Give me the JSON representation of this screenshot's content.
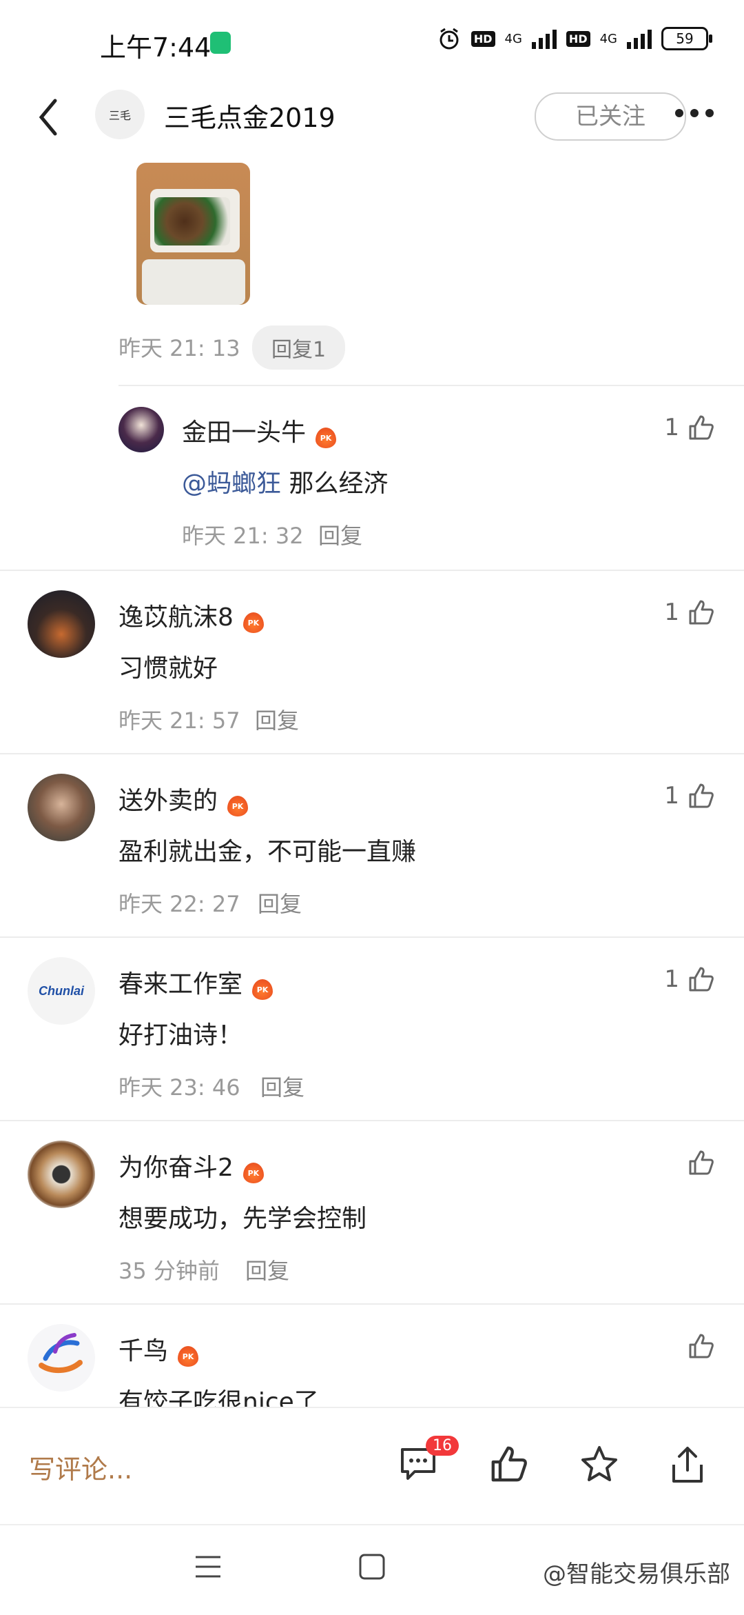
{
  "status_bar": {
    "time": "上午7:44",
    "hd1": "HD",
    "net1": "4G",
    "hd2": "HD",
    "net2": "4G",
    "battery": "59"
  },
  "header": {
    "avatar_text": "三毛",
    "title": "三毛点金2019",
    "follow_label": "已关注"
  },
  "first_reply": {
    "time": "昨天 21: 13",
    "reply_label": "回复1"
  },
  "comments": [
    {
      "name": "金田一头牛",
      "mention": "@蚂螂狂",
      "text": " 那么经济",
      "time": "昨天 21: 32",
      "reply": "回复",
      "likes": "1",
      "badge": "PK"
    },
    {
      "name": "逸苡航沫8",
      "text": "习惯就好",
      "time": "昨天 21: 57",
      "reply": "回复",
      "likes": "1",
      "badge": "PK"
    },
    {
      "name": "送外卖的",
      "text": "盈利就出金，不可能一直赚",
      "time": "昨天 22: 27",
      "reply": "回复",
      "likes": "1",
      "badge": "PK"
    },
    {
      "name": "春来工作室",
      "avatar_text": "Chunlai",
      "text": "好打油诗！",
      "time": "昨天 23: 46",
      "reply": "回复",
      "likes": "1",
      "badge": "PK"
    },
    {
      "name": "为你奋斗2",
      "text": "想要成功，先学会控制",
      "time": "35 分钟前",
      "reply": "回复",
      "likes": "",
      "badge": "PK"
    },
    {
      "name": "千鸟",
      "text": "有饺子吃很nice了",
      "likes": "",
      "badge": "PK"
    }
  ],
  "bottom_bar": {
    "write_placeholder": "写评论...",
    "comment_count": "16"
  },
  "watermark": "@智能交易俱乐部"
}
